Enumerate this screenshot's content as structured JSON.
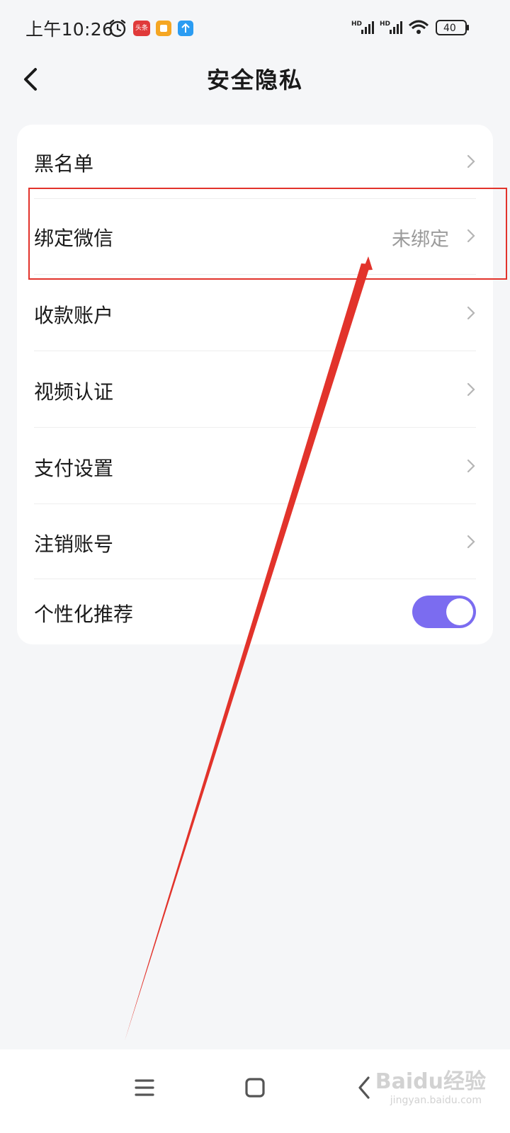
{
  "status_bar": {
    "time": "上午10:26",
    "toutiao_badge": "头条",
    "battery": "40",
    "signal_label_1": "HD",
    "signal_label_2": "HD"
  },
  "header": {
    "title": "安全隐私"
  },
  "settings": {
    "items": [
      {
        "label": "黑名单",
        "value": ""
      },
      {
        "label": "绑定微信",
        "value": "未绑定"
      },
      {
        "label": "收款账户",
        "value": ""
      },
      {
        "label": "视频认证",
        "value": ""
      },
      {
        "label": "支付设置",
        "value": ""
      },
      {
        "label": "注销账号",
        "value": ""
      },
      {
        "label": "个性化推荐",
        "value": "",
        "toggle_on": true
      }
    ]
  },
  "watermark": {
    "text": "Baidu经验",
    "sub": "jingyan.baidu.com"
  },
  "colors": {
    "accent_toggle": "#7b6cf0",
    "annotation": "#e2332b",
    "background": "#f5f6f8"
  }
}
